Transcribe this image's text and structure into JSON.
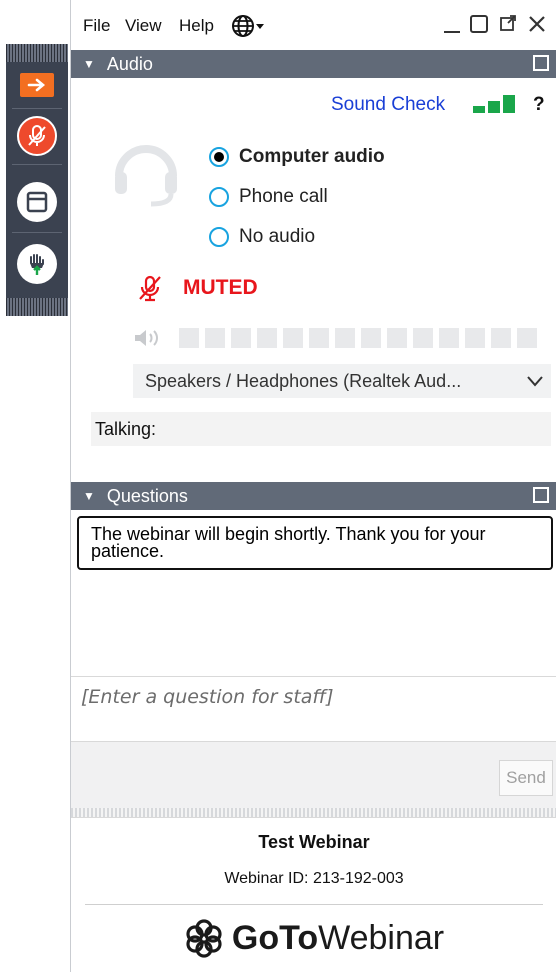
{
  "menu": {
    "file": "File",
    "view": "View",
    "help": "Help"
  },
  "audio": {
    "section_title": "Audio",
    "sound_check": "Sound Check",
    "help_mark": "?",
    "options": [
      {
        "label": "Computer audio",
        "selected": true
      },
      {
        "label": "Phone call",
        "selected": false
      },
      {
        "label": "No audio",
        "selected": false
      }
    ],
    "muted_label": "MUTED",
    "device": "Speakers / Headphones (Realtek Aud...",
    "talking_label": "Talking:"
  },
  "questions": {
    "section_title": "Questions",
    "message": "The webinar will begin shortly.  Thank you for your patience.",
    "input_placeholder": "[Enter a question for staff]",
    "send_label": "Send"
  },
  "footer": {
    "webinar_title": "Test Webinar",
    "webinar_id": "Webinar ID: 213-192-003",
    "brand_bold": "GoTo",
    "brand_regular": "Webinar"
  },
  "colors": {
    "accent_orange": "#f36f21",
    "muted_red": "#e8161c",
    "link_blue": "#1a3fd6",
    "section_bar": "#616a78",
    "signal_green": "#1aa64a"
  }
}
